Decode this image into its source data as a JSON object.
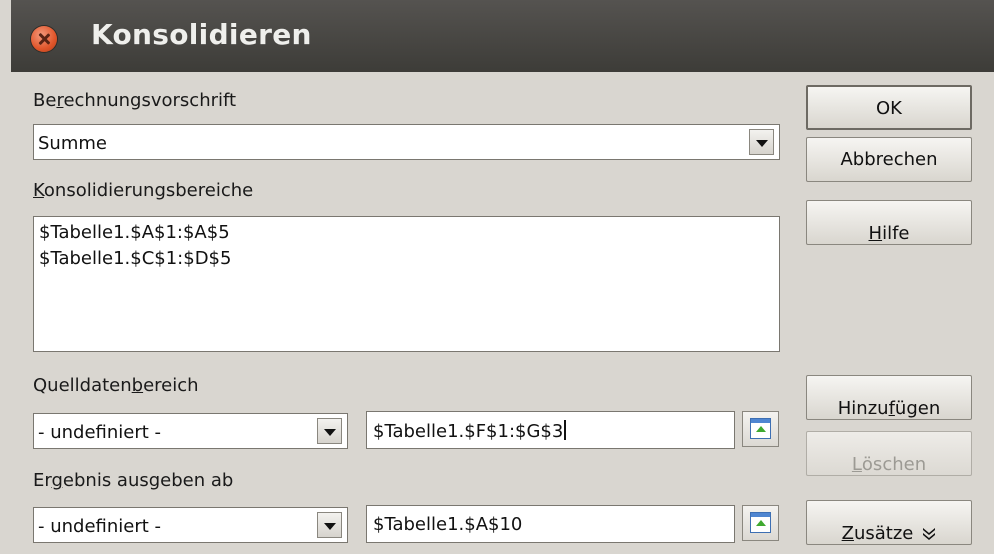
{
  "window": {
    "title": "Konsolidieren"
  },
  "function": {
    "label_pre": "Be",
    "label_key": "r",
    "label_post": "echnungsvorschrift",
    "value": "Summe"
  },
  "ranges": {
    "label_key": "K",
    "label_post": "onsolidierungsbereiche",
    "items": [
      "$Tabelle1.$A$1:$A$5",
      "$Tabelle1.$C$1:$D$5"
    ]
  },
  "source": {
    "label_pre": "Quelldaten",
    "label_key": "b",
    "label_post": "ereich",
    "combo_value": "- undefiniert -",
    "field_value": "$Tabelle1.$F$1:$G$3"
  },
  "output": {
    "label_pre": "Er",
    "label_key": "g",
    "label_post": "ebnis ausgeben ab",
    "combo_value": "- undefiniert -",
    "field_value": "$Tabelle1.$A$10"
  },
  "buttons": {
    "ok": "OK",
    "cancel": "Abbrechen",
    "help_key": "H",
    "help_post": "ilfe",
    "add_pre": "Hinzu",
    "add_key": "f",
    "add_post": "ügen",
    "delete_key": "L",
    "delete_post": "öschen",
    "more_key": "Z",
    "more_post": "usätze",
    "more_icon": "double-chevron-down"
  },
  "colors": {
    "titlebar": "#3d3c38",
    "dialog_bg": "#d9d6d0",
    "close_button": "#e0552a",
    "disabled_text": "#9c9a94"
  }
}
